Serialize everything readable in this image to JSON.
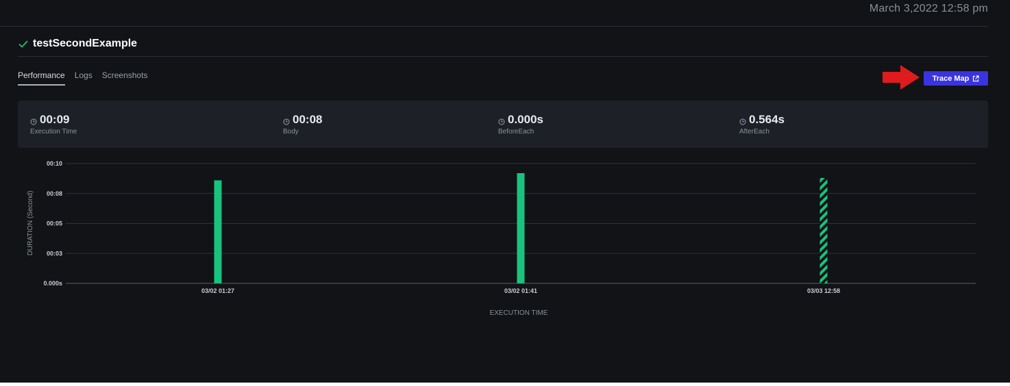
{
  "header": {
    "timestamp": "March 3,2022 12:58 pm"
  },
  "test": {
    "title": "testSecondExample",
    "status": "passed"
  },
  "tabs": [
    {
      "label": "Performance",
      "active": true
    },
    {
      "label": "Logs",
      "active": false
    },
    {
      "label": "Screenshots",
      "active": false
    }
  ],
  "actions": {
    "trace_map_label": "Trace Map"
  },
  "stats": [
    {
      "value": "00:09",
      "label": "Execution Time"
    },
    {
      "value": "00:08",
      "label": "Body"
    },
    {
      "value": "0.000s",
      "label": "BeforeEach"
    },
    {
      "value": "0.564s",
      "label": "AfterEach"
    }
  ],
  "icons": {
    "status": "check-icon",
    "annotation": "red-arrow-icon",
    "external": "external-link-icon",
    "stat": "clock-icon"
  },
  "colors": {
    "background": "#111317",
    "panel": "#1d2127",
    "accent": "#3a33e0",
    "success": "#19c37d",
    "arrow": "#e01b1b"
  },
  "chart_data": {
    "type": "bar",
    "categories": [
      "03/02 01:27",
      "03/02 01:41",
      "03/03 12:58"
    ],
    "values": [
      8.6,
      9.2,
      8.8
    ],
    "patterns": [
      "solid",
      "solid",
      "hatched"
    ],
    "ylim": [
      0,
      10
    ],
    "yticks": [
      0,
      2.5,
      5,
      7.5,
      10
    ],
    "ytick_labels": [
      "0.000s",
      "00:03",
      "00:05",
      "00:08",
      "00:10"
    ],
    "xlabel": "EXECUTION TIME",
    "ylabel": "DURATION (Second)",
    "grid": true
  }
}
